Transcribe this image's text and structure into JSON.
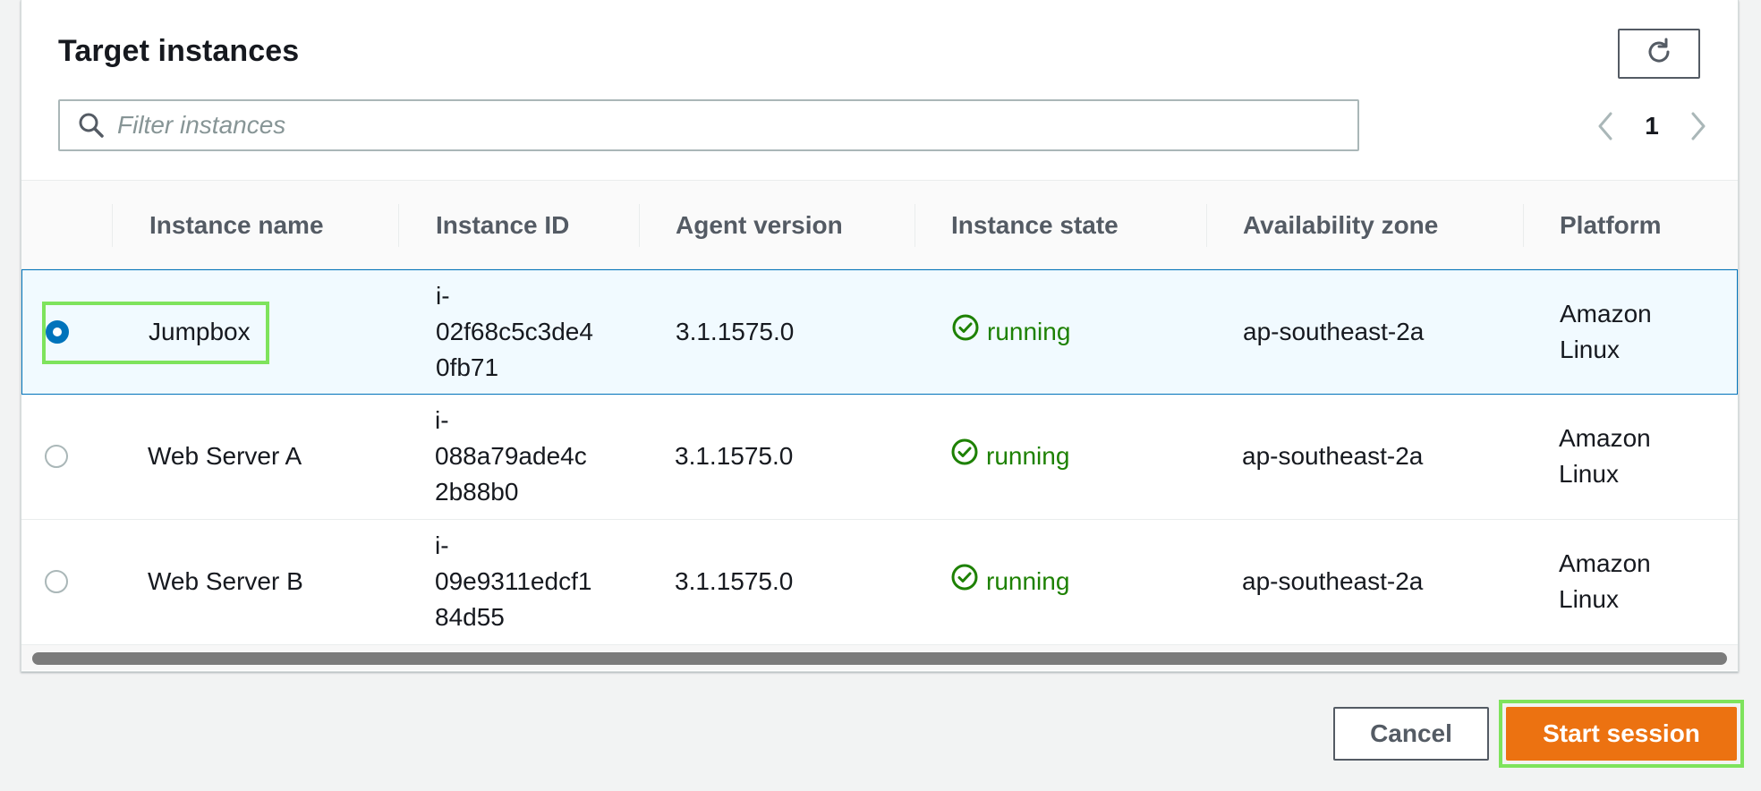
{
  "panel": {
    "title": "Target instances",
    "refresh_icon": "refresh-icon"
  },
  "search": {
    "placeholder": "Filter instances",
    "value": "",
    "icon": "search-icon"
  },
  "pagination": {
    "current_page": "1",
    "prev_icon": "chevron-left-icon",
    "next_icon": "chevron-right-icon"
  },
  "table": {
    "columns": [
      "Instance name",
      "Instance ID",
      "Agent version",
      "Instance state",
      "Availability zone",
      "Platform"
    ],
    "rows": [
      {
        "selected": true,
        "name": "Jumpbox",
        "id_lines": [
          "i-",
          "02f68c5c3de4",
          "0fb71"
        ],
        "agent_version": "3.1.1575.0",
        "state": "running",
        "zone": "ap-southeast-2a",
        "platform_lines": [
          "Amazon",
          "Linux"
        ]
      },
      {
        "selected": false,
        "name": "Web Server A",
        "id_lines": [
          "i-",
          "088a79ade4c",
          "2b88b0"
        ],
        "agent_version": "3.1.1575.0",
        "state": "running",
        "zone": "ap-southeast-2a",
        "platform_lines": [
          "Amazon",
          "Linux"
        ]
      },
      {
        "selected": false,
        "name": "Web Server B",
        "id_lines": [
          "i-",
          "09e9311edcf1",
          "84d55"
        ],
        "agent_version": "3.1.1575.0",
        "state": "running",
        "zone": "ap-southeast-2a",
        "platform_lines": [
          "Amazon",
          "Linux"
        ]
      }
    ]
  },
  "actions": {
    "cancel_label": "Cancel",
    "start_label": "Start session"
  },
  "colors": {
    "primary": "#ec7211",
    "selected_row_bg": "#f1faff",
    "selected_border": "#0073bb",
    "running": "#1d8102",
    "highlight": "#7ee35c"
  }
}
